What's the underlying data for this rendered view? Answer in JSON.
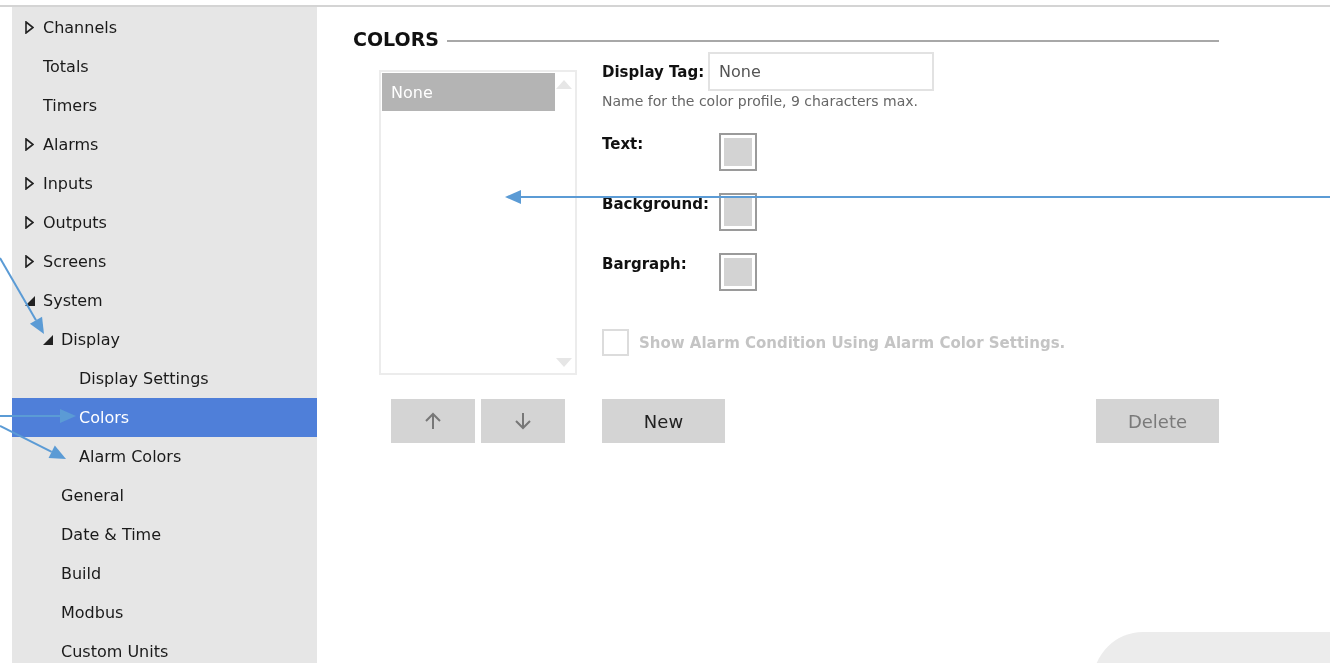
{
  "sidebar": {
    "items": [
      {
        "label": "Channels",
        "expanded": false,
        "selected": false
      },
      {
        "label": "Totals",
        "selected": false
      },
      {
        "label": "Timers",
        "selected": false
      },
      {
        "label": "Alarms",
        "expanded": false,
        "selected": false
      },
      {
        "label": "Inputs",
        "expanded": false,
        "selected": false
      },
      {
        "label": "Outputs",
        "expanded": false,
        "selected": false
      },
      {
        "label": "Screens",
        "expanded": false,
        "selected": false
      },
      {
        "label": "System",
        "expanded": true,
        "selected": false,
        "children": [
          {
            "label": "Display",
            "expanded": true,
            "selected": false,
            "children": [
              {
                "label": "Display Settings",
                "selected": false
              },
              {
                "label": "Colors",
                "selected": true
              },
              {
                "label": "Alarm Colors",
                "selected": false
              }
            ]
          },
          {
            "label": "General",
            "selected": false
          },
          {
            "label": "Date & Time",
            "selected": false
          },
          {
            "label": "Build",
            "selected": false
          },
          {
            "label": "Modbus",
            "selected": false
          },
          {
            "label": "Custom Units",
            "selected": false
          }
        ]
      }
    ]
  },
  "section": {
    "title": "COLORS"
  },
  "profiles": {
    "items": [
      {
        "label": "None",
        "selected": true
      }
    ]
  },
  "form": {
    "display_tag": {
      "label": "Display Tag:",
      "value": "None",
      "hint": "Name for the color profile, 9 characters max."
    },
    "colors": [
      {
        "label": "Text:",
        "color": "#d3d3d3"
      },
      {
        "label": "Background:",
        "color": "#d3d3d3"
      },
      {
        "label": "Bargraph:",
        "color": "#d3d3d3"
      }
    ],
    "alarm_option": {
      "label": "Show Alarm Condition Using Alarm Color Settings.",
      "checked": false,
      "disabled": true
    }
  },
  "buttons": [
    {
      "kind": "up"
    },
    {
      "kind": "down"
    },
    {
      "kind": "new",
      "label": "New",
      "disabled": false
    },
    {
      "kind": "delete",
      "label": "Delete",
      "disabled": true
    }
  ]
}
